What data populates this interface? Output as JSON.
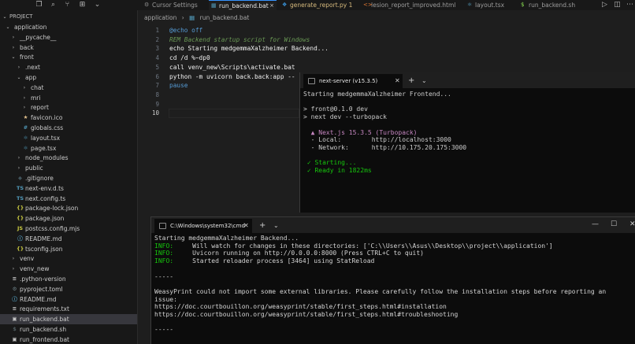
{
  "titlebar": {
    "tabs": [
      {
        "label": "Cursor Settings",
        "icon": "gear-icon",
        "active": false
      },
      {
        "label": "run_backend.bat",
        "icon": "windows-icon",
        "active": true
      },
      {
        "label": "generate_report.py 1",
        "icon": "python-icon",
        "active": false
      },
      {
        "label": "lesion_report_improved.html",
        "icon": "html-icon",
        "active": false
      },
      {
        "label": "layout.tsx",
        "icon": "react-icon",
        "active": false
      },
      {
        "label": "run_backend.sh",
        "icon": "shell-icon",
        "active": false
      }
    ],
    "close_glyph": "×"
  },
  "sidebar": {
    "title": "PROJECT",
    "items": [
      {
        "label": "application",
        "depth": 1,
        "type": "folder-open",
        "chevron": "⌄"
      },
      {
        "label": "__pycache__",
        "depth": 2,
        "type": "folder",
        "chevron": "›"
      },
      {
        "label": "back",
        "depth": 2,
        "type": "folder",
        "chevron": "›"
      },
      {
        "label": "front",
        "depth": 2,
        "type": "folder-open",
        "chevron": "⌄"
      },
      {
        "label": ".next",
        "depth": 3,
        "type": "folder",
        "chevron": "›"
      },
      {
        "label": "app",
        "depth": 3,
        "type": "folder-open",
        "chevron": "⌄"
      },
      {
        "label": "chat",
        "depth": 4,
        "type": "folder",
        "chevron": "›"
      },
      {
        "label": "mri",
        "depth": 4,
        "type": "folder",
        "chevron": "›"
      },
      {
        "label": "report",
        "depth": 4,
        "type": "folder",
        "chevron": "›"
      },
      {
        "label": "favicon.ico",
        "depth": 4,
        "type": "file",
        "icon": "★",
        "color": "#e2c08d"
      },
      {
        "label": "globals.css",
        "depth": 4,
        "type": "file",
        "icon": "#",
        "color": "#519aba"
      },
      {
        "label": "layout.tsx",
        "depth": 4,
        "type": "file",
        "icon": "⚛",
        "color": "#519aba"
      },
      {
        "label": "page.tsx",
        "depth": 4,
        "type": "file",
        "icon": "⚛",
        "color": "#519aba"
      },
      {
        "label": "node_modules",
        "depth": 3,
        "type": "folder",
        "chevron": "›"
      },
      {
        "label": "public",
        "depth": 3,
        "type": "folder",
        "chevron": "›"
      },
      {
        "label": ".gitignore",
        "depth": 3,
        "type": "file",
        "icon": "◆",
        "color": "#41535b"
      },
      {
        "label": "next-env.d.ts",
        "depth": 3,
        "type": "file",
        "icon": "TS",
        "color": "#519aba"
      },
      {
        "label": "next.config.ts",
        "depth": 3,
        "type": "file",
        "icon": "TS",
        "color": "#519aba"
      },
      {
        "label": "package-lock.json",
        "depth": 3,
        "type": "file",
        "icon": "{}",
        "color": "#cbcb41"
      },
      {
        "label": "package.json",
        "depth": 3,
        "type": "file",
        "icon": "{}",
        "color": "#cbcb41"
      },
      {
        "label": "postcss.config.mjs",
        "depth": 3,
        "type": "file",
        "icon": "JS",
        "color": "#cbcb41"
      },
      {
        "label": "README.md",
        "depth": 3,
        "type": "file",
        "icon": "ⓘ",
        "color": "#519aba"
      },
      {
        "label": "tsconfig.json",
        "depth": 3,
        "type": "file",
        "icon": "{}",
        "color": "#cbcb41"
      },
      {
        "label": "venv",
        "depth": 2,
        "type": "folder",
        "chevron": "›"
      },
      {
        "label": "venv_new",
        "depth": 2,
        "type": "folder",
        "chevron": "›"
      },
      {
        "label": ".python-version",
        "depth": 2,
        "type": "file",
        "icon": "≡",
        "color": "#cccccc"
      },
      {
        "label": "pyproject.toml",
        "depth": 2,
        "type": "file",
        "icon": "⚙",
        "color": "#6d8086"
      },
      {
        "label": "README.md",
        "depth": 2,
        "type": "file",
        "icon": "ⓘ",
        "color": "#519aba"
      },
      {
        "label": "requirements.txt",
        "depth": 2,
        "type": "file",
        "icon": "≡",
        "color": "#cccccc"
      },
      {
        "label": "run_backend.bat",
        "depth": 2,
        "type": "file",
        "icon": "▣",
        "color": "#c1c1c1",
        "selected": true
      },
      {
        "label": "run_backend.sh",
        "depth": 2,
        "type": "file",
        "icon": "$",
        "color": "#4d5a5e"
      },
      {
        "label": "run_frontend.bat",
        "depth": 2,
        "type": "file",
        "icon": "▣",
        "color": "#c1c1c1"
      }
    ]
  },
  "breadcrumb": {
    "parts": [
      "application",
      "›",
      "run_backend.bat"
    ]
  },
  "editor": {
    "line_numbers": [
      "1",
      "2",
      "3",
      "4",
      "5",
      "6",
      "7",
      "8",
      "9",
      "10"
    ],
    "lines": [
      "@echo off",
      "REM Backend startup script for Windows",
      "echo Starting medgemmaXalzheimer Backend...",
      "cd /d %~dp0",
      "call venv_new\\Scripts\\activate.bat",
      "python -m uvicorn back.back:app --",
      "pause",
      "",
      "",
      ""
    ]
  },
  "terminal_next": {
    "tab_label": "next-server (v15.3.5)",
    "plus": "+",
    "dropdown": "⌄",
    "lines": [
      {
        "text": "Starting medgemmaXalzheimer Frontend...",
        "class": "c-gray"
      },
      {
        "text": "",
        "class": "c-gray"
      },
      {
        "text": "> front@0.1.0 dev",
        "class": "c-gray"
      },
      {
        "text": "> next dev --turbopack",
        "class": "c-gray"
      },
      {
        "text": "",
        "class": "c-gray"
      },
      {
        "text": "  ▲ Next.js 15.3.5 (Turbopack)",
        "class": "c-gray"
      },
      {
        "text": "  - Local:        http://localhost:3000",
        "class": "c-gray"
      },
      {
        "text": "  - Network:      http://10.175.20.175:3000",
        "class": "c-gray"
      },
      {
        "text": "",
        "class": "c-gray"
      },
      {
        "text": " ✓ Starting...",
        "class": "c-gray"
      },
      {
        "text": " ✓ Ready in 1822ms",
        "class": "c-gray"
      }
    ]
  },
  "terminal_cmd": {
    "tab_label": "C:\\Windows\\system32\\cmd",
    "plus": "+",
    "dropdown": "⌄",
    "controls": {
      "minimize": "—",
      "maximize": "☐",
      "close": "✕"
    },
    "lines": [
      {
        "prefix": "",
        "text": "Starting medgemmaXalzheimer Backend..."
      },
      {
        "prefix": "INFO:",
        "text": "     Will watch for changes in these directories: ['C:\\\\Users\\\\Asus\\\\Desktop\\\\project\\\\application']"
      },
      {
        "prefix": "INFO:",
        "text": "     Uvicorn running on http://0.0.0.0:8000 (Press CTRL+C to quit)"
      },
      {
        "prefix": "INFO:",
        "text": "     Started reloader process [3464] using StatReload"
      },
      {
        "prefix": "",
        "text": ""
      },
      {
        "prefix": "",
        "text": "-----"
      },
      {
        "prefix": "",
        "text": ""
      },
      {
        "prefix": "",
        "text": "WeasyPrint could not import some external libraries. Please carefully follow the installation steps before reporting an"
      },
      {
        "prefix": "",
        "text": "issue:"
      },
      {
        "prefix": "",
        "text": "https://doc.courtbouillon.org/weasyprint/stable/first_steps.html#installation"
      },
      {
        "prefix": "",
        "text": "https://doc.courtbouillon.org/weasyprint/stable/first_steps.html#troubleshooting"
      },
      {
        "prefix": "",
        "text": ""
      },
      {
        "prefix": "",
        "text": "-----"
      }
    ]
  },
  "colors": {
    "accent": "#3794ff",
    "info_green": "#16c60c",
    "link_cyan": "#3a96dd"
  }
}
